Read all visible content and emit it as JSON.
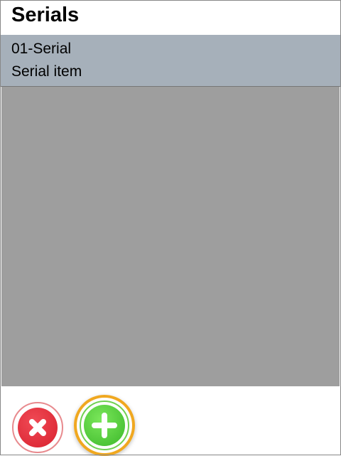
{
  "header": {
    "title": "Serials"
  },
  "selected_item": {
    "line1": "01-Serial",
    "line2": "Serial item"
  },
  "footer": {
    "cancel_icon": "close-icon",
    "add_icon": "plus-icon"
  },
  "colors": {
    "selected_row": "#a6b0ba",
    "list_bg": "#9e9e9e",
    "cancel": "#e02a36",
    "add": "#4cc83a",
    "focus_ring": "#f0a820"
  }
}
